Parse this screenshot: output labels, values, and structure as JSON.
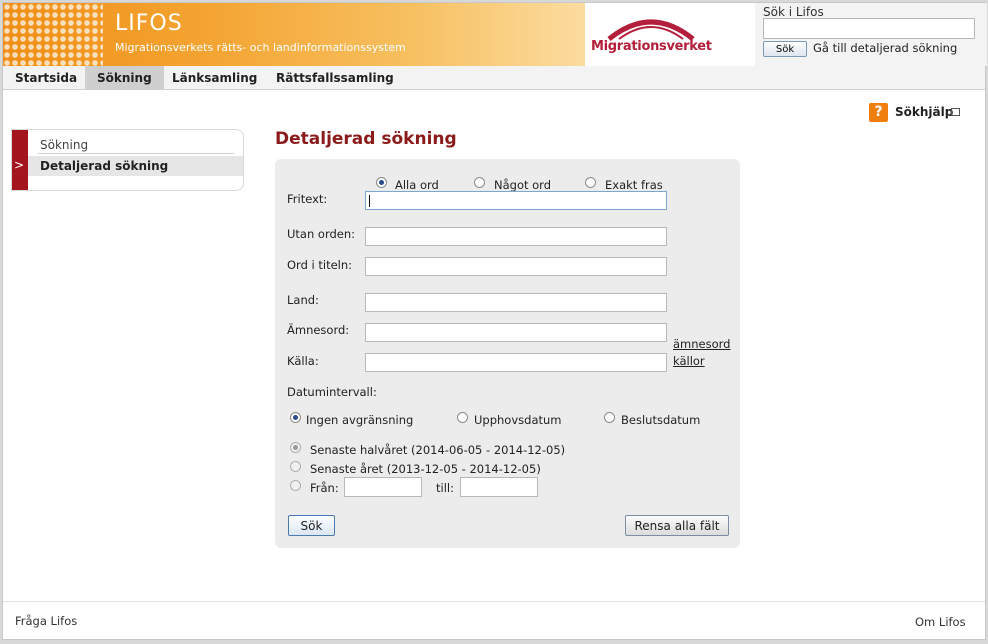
{
  "header": {
    "logo_title": "LIFOS",
    "logo_subtitle": "Migrationsverkets rätts- och landinformationssystem",
    "agency_name": "Migrationsverket",
    "search_label": "Sök i Lifos",
    "search_value": "",
    "search_button": "Sök",
    "detailed_link": "Gå till detaljerad sökning"
  },
  "nav": {
    "items": [
      {
        "label": "Startsida"
      },
      {
        "label": "Sökning"
      },
      {
        "label": "Länksamling"
      },
      {
        "label": "Rättsfallssamling"
      }
    ],
    "active": "Sökning"
  },
  "help": {
    "label": "Sökhjälp",
    "icon": "question-icon"
  },
  "sidebar": {
    "items": [
      {
        "label": "Sökning"
      },
      {
        "label": "Detaljerad sökning"
      }
    ],
    "active_marker": ">"
  },
  "main": {
    "title": "Detaljerad sökning",
    "mode_options": [
      {
        "label": "Alla ord",
        "selected": true
      },
      {
        "label": "Något ord",
        "selected": false
      },
      {
        "label": "Exakt fras",
        "selected": false
      }
    ],
    "fields": {
      "fritext": {
        "label": "Fritext:",
        "value": ""
      },
      "utan": {
        "label": "Utan orden:",
        "value": ""
      },
      "titel": {
        "label": "Ord i titeln:",
        "value": ""
      },
      "land": {
        "label": "Land:",
        "value": ""
      },
      "amnesord": {
        "label": "Ämnesord:",
        "value": "",
        "link": "ämnesord"
      },
      "kalla": {
        "label": "Källa:",
        "value": "",
        "link": "källor"
      }
    },
    "date_label": "Datumintervall:",
    "date_types": [
      {
        "label": "Ingen avgränsning",
        "selected": true
      },
      {
        "label": "Upphovsdatum",
        "selected": false
      },
      {
        "label": "Beslutsdatum",
        "selected": false
      }
    ],
    "ranges": [
      {
        "label": "Senaste halvåret (2014-06-05 - 2014-12-05)",
        "selected": true
      },
      {
        "label": "Senaste året (2013-12-05 - 2014-12-05)",
        "selected": false
      },
      {
        "label": "Från:",
        "selected": false
      }
    ],
    "from_value": "",
    "to_label": "till:",
    "to_value": "",
    "search_button": "Sök",
    "clear_button": "Rensa alla fält"
  },
  "footer": {
    "left": "Fråga Lifos",
    "right": "Om Lifos"
  },
  "colors": {
    "brand_red": "#a3141e",
    "title_red": "#8b1a1a",
    "banner_orange": "#f09018",
    "help_orange": "#f07e0f"
  }
}
